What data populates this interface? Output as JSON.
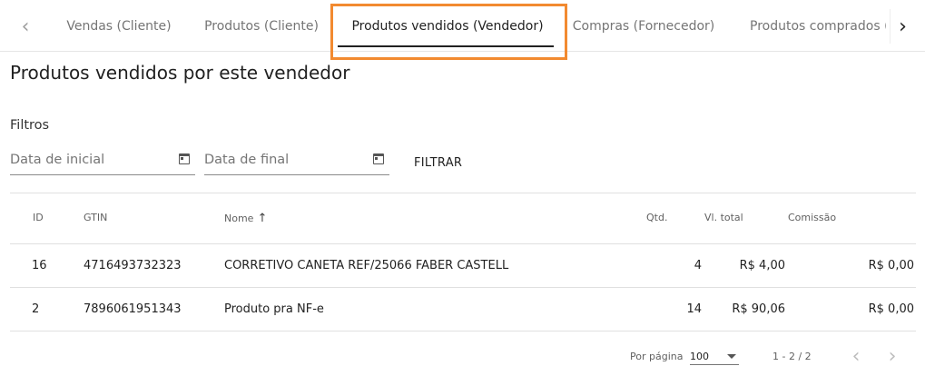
{
  "tabs": [
    {
      "label": "Vendas (Cliente)",
      "active": false
    },
    {
      "label": "Produtos (Cliente)",
      "active": false
    },
    {
      "label": "Produtos vendidos (Vendedor)",
      "active": true
    },
    {
      "label": "Compras (Fornecedor)",
      "active": false
    },
    {
      "label": "Produtos comprados (Fornecedor)",
      "active": false
    }
  ],
  "nav": {
    "prev_icon": "chevron-left-icon",
    "next_icon": "chevron-right-icon"
  },
  "colors": {
    "highlight": "#f28a30",
    "text": "#212121",
    "muted": "#757575"
  },
  "page_title": "Produtos vendidos por este vendedor",
  "filters": {
    "label": "Filtros",
    "start_placeholder": "Data de inicial",
    "end_placeholder": "Data de final",
    "button_label": "FILTRAR"
  },
  "table": {
    "columns": [
      "ID",
      "GTIN",
      "Nome",
      "Qtd.",
      "Vl. total",
      "Comissão"
    ],
    "rows": [
      {
        "id": "16",
        "gtin": "4716493732323",
        "name": "CORRETIVO CANETA REF/25066 FABER CASTELL",
        "qty": "4",
        "total": "R$ 4,00",
        "commission": "R$ 0,00"
      },
      {
        "id": "2",
        "gtin": "7896061951343",
        "name": "Produto pra NF-e",
        "qty": "14",
        "total": "R$ 90,06",
        "commission": "R$ 0,00"
      }
    ]
  },
  "pagination": {
    "per_page_label": "Por página",
    "per_page_value": "100",
    "range_text": "1 - 2 / 2"
  }
}
